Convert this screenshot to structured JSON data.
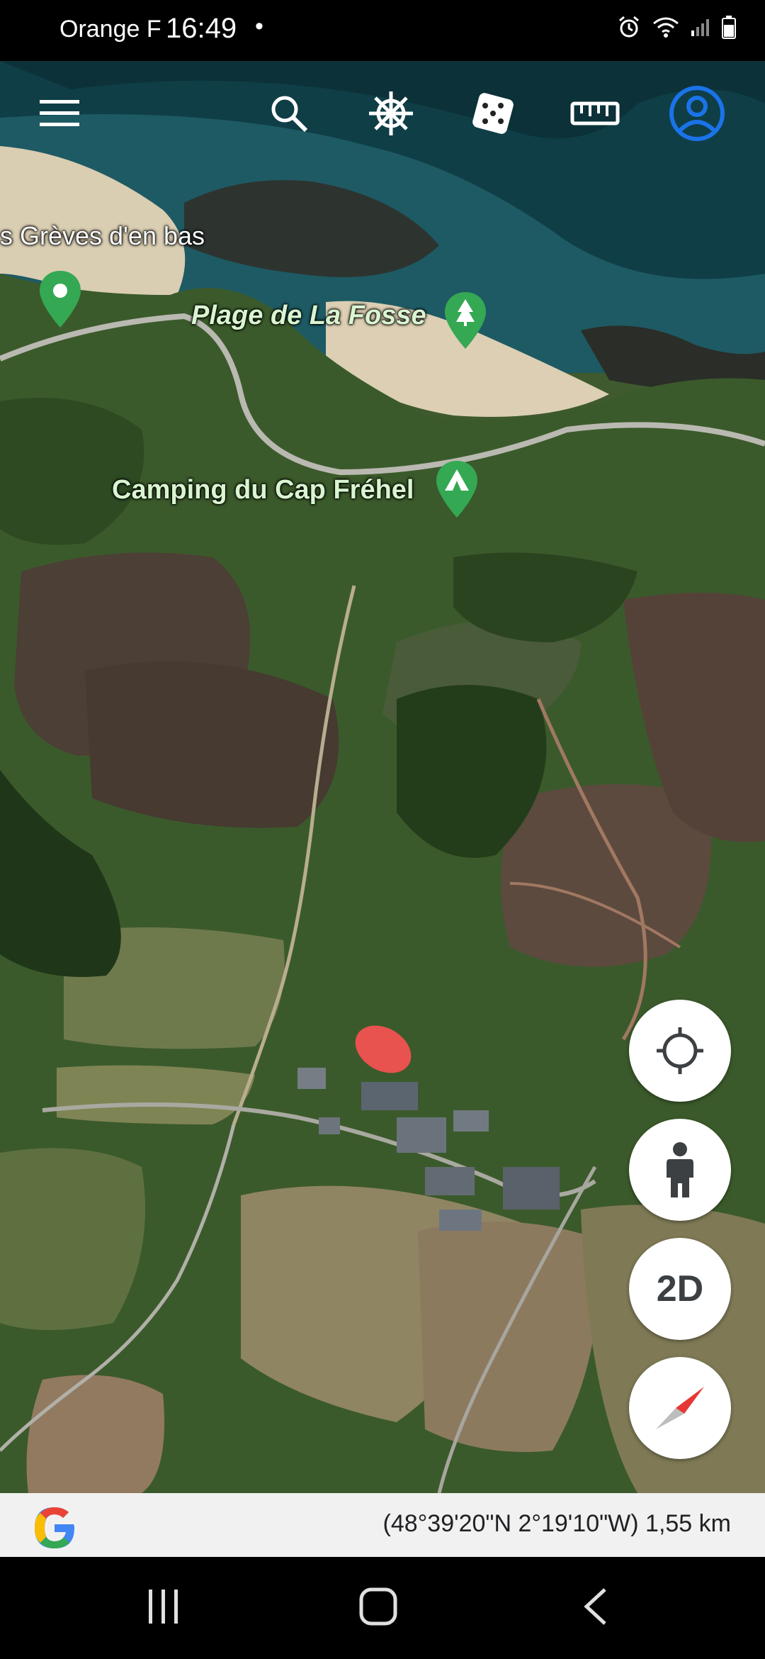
{
  "status_bar": {
    "carrier": "Orange F",
    "time": "16:49",
    "dot": "•"
  },
  "toolbar": {
    "menu": "menu-icon",
    "search": "search-icon",
    "voyager": "ship-wheel-icon",
    "feeling_lucky": "dice-icon",
    "measure": "ruler-icon",
    "account": "account-circle-icon",
    "accent_color": "#1a73e8"
  },
  "map_labels": {
    "greves": "s Grèves d'en bas",
    "plage": "Plage de La Fosse",
    "camping": "Camping du Cap Fréhel"
  },
  "controls": {
    "locate": "my-location-icon",
    "street_view": "pegman-icon",
    "view_mode": "2D",
    "compass": "compass-icon"
  },
  "info_bar": {
    "coordinates": "(48°39'20\"N 2°19'10\"W) 1,55 km"
  },
  "nav_bar": {
    "recent": "recent-apps-icon",
    "home": "home-icon",
    "back": "back-icon"
  },
  "colors": {
    "pin_green": "#34a853",
    "marker_red": "#e8524f"
  }
}
